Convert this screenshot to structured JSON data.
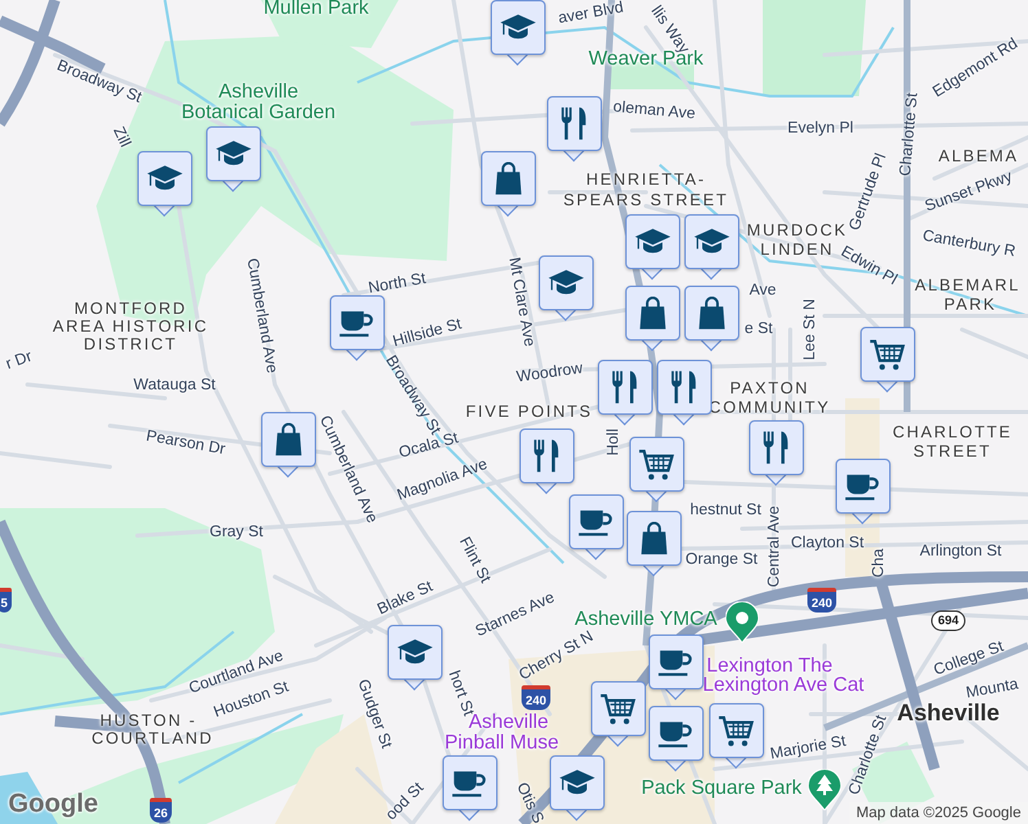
{
  "map": {
    "labels": [
      {
        "kind": "park",
        "text": "Mullen Park"
      },
      {
        "kind": "street",
        "text": "aver Blvd"
      },
      {
        "kind": "street",
        "text": "llis Way"
      },
      {
        "kind": "park",
        "text": "Weaver Park"
      },
      {
        "kind": "street",
        "text": "Broadway St"
      },
      {
        "kind": "park",
        "text": "Asheville"
      },
      {
        "kind": "park",
        "text": "Botanical Garden"
      },
      {
        "kind": "street",
        "text": "oleman Ave"
      },
      {
        "kind": "street",
        "text": "Evelyn Pl"
      },
      {
        "kind": "street",
        "text": "Edgemont Rd"
      },
      {
        "kind": "street",
        "text": "Charlotte St"
      },
      {
        "kind": "district",
        "text": "ALBEMA"
      },
      {
        "kind": "street",
        "text": "Gertrude Pl"
      },
      {
        "kind": "street",
        "text": "Sunset Pkwy"
      },
      {
        "kind": "street",
        "text": "Zill"
      },
      {
        "kind": "district",
        "text": "HENRIETTA-"
      },
      {
        "kind": "district",
        "text": "SPEARS STREET"
      },
      {
        "kind": "district",
        "text": "MURDOCK"
      },
      {
        "kind": "district",
        "text": "LINDEN"
      },
      {
        "kind": "street",
        "text": "Edwin Pl"
      },
      {
        "kind": "street",
        "text": "Canterbury R"
      },
      {
        "kind": "district",
        "text": "ALBEMARL"
      },
      {
        "kind": "district",
        "text": "PARK"
      },
      {
        "kind": "street",
        "text": "Ave"
      },
      {
        "kind": "street",
        "text": "North St"
      },
      {
        "kind": "street",
        "text": "Mt Clare Ave"
      },
      {
        "kind": "street",
        "text": "Cumberland Ave"
      },
      {
        "kind": "district",
        "text": "MONTFORD"
      },
      {
        "kind": "district",
        "text": "AREA HISTORIC"
      },
      {
        "kind": "district",
        "text": "DISTRICT"
      },
      {
        "kind": "street",
        "text": "e St"
      },
      {
        "kind": "street",
        "text": "Hillside St"
      },
      {
        "kind": "street",
        "text": "Lee St N"
      },
      {
        "kind": "street",
        "text": "r Dr"
      },
      {
        "kind": "street",
        "text": "Broadway St"
      },
      {
        "kind": "street",
        "text": "Watauga St"
      },
      {
        "kind": "street",
        "text": "Woodrow"
      },
      {
        "kind": "district",
        "text": "PAXTON"
      },
      {
        "kind": "district",
        "text": "COMMUNITY"
      },
      {
        "kind": "district",
        "text": "CHARLOTTE"
      },
      {
        "kind": "district",
        "text": "STREET"
      },
      {
        "kind": "street",
        "text": "Pearson Dr"
      },
      {
        "kind": "district",
        "text": "FIVE POINTS"
      },
      {
        "kind": "street",
        "text": "Ocala St"
      },
      {
        "kind": "street",
        "text": "Holl"
      },
      {
        "kind": "street",
        "text": "Magnolia Ave"
      },
      {
        "kind": "street",
        "text": "Cumberland Ave"
      },
      {
        "kind": "street",
        "text": "hestnut St"
      },
      {
        "kind": "street",
        "text": "Gray St"
      },
      {
        "kind": "street",
        "text": "Central Ave"
      },
      {
        "kind": "street",
        "text": "Clayton St"
      },
      {
        "kind": "street",
        "text": "Cha"
      },
      {
        "kind": "street",
        "text": "Orange St"
      },
      {
        "kind": "street",
        "text": "Arlington St"
      },
      {
        "kind": "street",
        "text": "Flint St"
      },
      {
        "kind": "street",
        "text": "Blake St"
      },
      {
        "kind": "street",
        "text": "Starnes Ave"
      },
      {
        "kind": "street",
        "text": "Cherry St N"
      },
      {
        "kind": "street",
        "text": "College St"
      },
      {
        "kind": "street",
        "text": "hort St"
      },
      {
        "kind": "street",
        "text": "Courtland Ave"
      },
      {
        "kind": "street",
        "text": "Houston St"
      },
      {
        "kind": "street",
        "text": "Gudger St"
      },
      {
        "kind": "city",
        "text": "Asheville"
      },
      {
        "kind": "street",
        "text": "Mounta"
      },
      {
        "kind": "district",
        "text": "HUSTON -"
      },
      {
        "kind": "district",
        "text": "COURTLAND"
      },
      {
        "kind": "museum",
        "text": "Asheville"
      },
      {
        "kind": "museum",
        "text": "Pinball Muse"
      },
      {
        "kind": "museum",
        "text": "Lexington The"
      },
      {
        "kind": "museum",
        "text": "Lexington Ave Cat"
      },
      {
        "kind": "street",
        "text": "Charlotte St"
      },
      {
        "kind": "street",
        "text": "Marjorie St"
      },
      {
        "kind": "street",
        "text": "Otis S"
      },
      {
        "kind": "street",
        "text": "ood St"
      }
    ],
    "places": [
      {
        "kind": "fitness",
        "text": "Asheville YMCA"
      },
      {
        "kind": "park",
        "text": "Pack Square Park"
      }
    ],
    "shields": [
      {
        "kind": "interstate",
        "text": "240"
      },
      {
        "kind": "interstate",
        "text": "240"
      },
      {
        "kind": "state",
        "text": "694"
      },
      {
        "kind": "interstate",
        "text": "26"
      },
      {
        "kind": "interstate",
        "text": "5"
      }
    ],
    "pins": [
      {
        "kind": "school"
      },
      {
        "kind": "restaurant"
      },
      {
        "kind": "shopping"
      },
      {
        "kind": "school"
      },
      {
        "kind": "school"
      },
      {
        "kind": "school"
      },
      {
        "kind": "school"
      },
      {
        "kind": "school"
      },
      {
        "kind": "shopping"
      },
      {
        "kind": "shopping"
      },
      {
        "kind": "cafe"
      },
      {
        "kind": "restaurant"
      },
      {
        "kind": "restaurant"
      },
      {
        "kind": "grocery"
      },
      {
        "kind": "shopping"
      },
      {
        "kind": "restaurant"
      },
      {
        "kind": "grocery"
      },
      {
        "kind": "restaurant"
      },
      {
        "kind": "cafe"
      },
      {
        "kind": "shopping"
      },
      {
        "kind": "cafe"
      },
      {
        "kind": "school"
      },
      {
        "kind": "cafe"
      },
      {
        "kind": "grocery"
      },
      {
        "kind": "cafe"
      },
      {
        "kind": "cafe"
      },
      {
        "kind": "school"
      },
      {
        "kind": "grocery"
      }
    ]
  },
  "attribution": {
    "logo": "Google",
    "text": "Map data ©2025 Google"
  }
}
